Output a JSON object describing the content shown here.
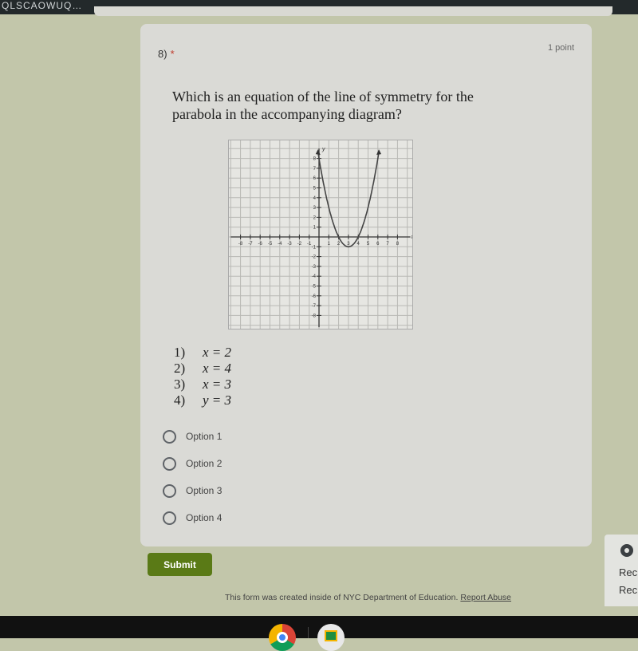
{
  "browser": {
    "url_fragment": "QLSCAOWUQ…"
  },
  "question": {
    "number": "8)",
    "required_marker": "*",
    "points": "1 point",
    "text": "Which is an equation of the line of symmetry for the parabola in the accompanying diagram?",
    "diagram": {
      "type": "parabola on coordinate grid",
      "x_axis_label": "x",
      "y_axis_label": "y",
      "x_ticks": [
        "-8",
        "-7",
        "-6",
        "-5",
        "-4",
        "-3",
        "-2",
        "-1",
        "1",
        "2",
        "3",
        "4",
        "5",
        "6",
        "7",
        "8"
      ],
      "y_ticks": [
        "8",
        "7",
        "6",
        "5",
        "4",
        "3",
        "2",
        "1",
        "-1",
        "-2",
        "-3",
        "-4",
        "-5",
        "-6",
        "-7",
        "-8"
      ],
      "xlim": [
        -8,
        8
      ],
      "ylim": [
        -8,
        8
      ],
      "vertex": [
        3,
        -1
      ],
      "x_intercepts": [
        2,
        4
      ],
      "equation": "y = (x-3)^2 - 1"
    },
    "choices": [
      {
        "n": "1)",
        "eq": "x = 2"
      },
      {
        "n": "2)",
        "eq": "x = 4"
      },
      {
        "n": "3)",
        "eq": "x = 3"
      },
      {
        "n": "4)",
        "eq": "y = 3"
      }
    ],
    "options": [
      "Option 1",
      "Option 2",
      "Option 3",
      "Option 4"
    ]
  },
  "form": {
    "submit_label": "Submit",
    "footer_text": "This form was created inside of NYC Department of Education.",
    "report_link": "Report Abuse"
  },
  "popup": {
    "line1": "Rec",
    "line2": "Rec"
  },
  "taskbar": {
    "apps": [
      "chrome-icon",
      "google-classroom-icon"
    ]
  }
}
